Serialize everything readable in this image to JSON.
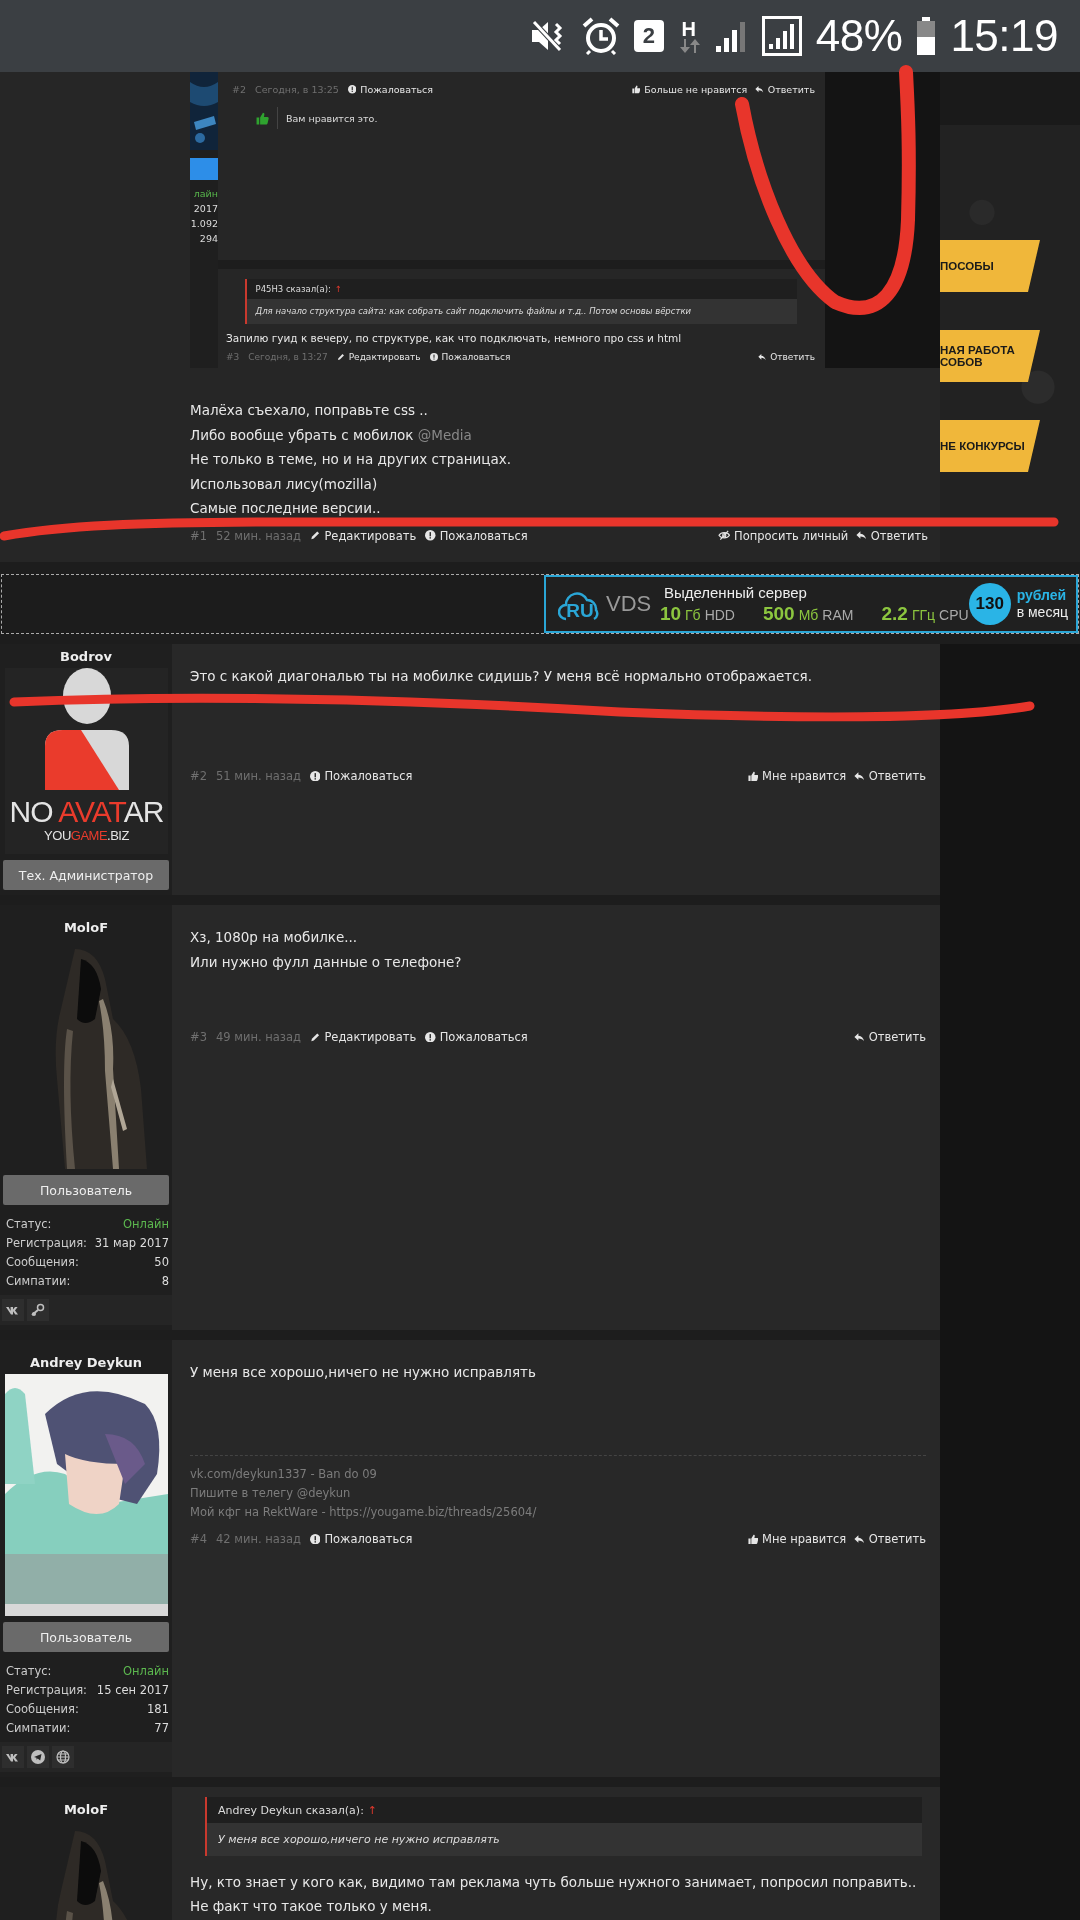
{
  "status_bar": {
    "sim_slot": "2",
    "network": "H",
    "battery": "48%",
    "time": "15:19"
  },
  "first_post": {
    "embedded_screenshot": {
      "user_fragment": {
        "status": "лайн",
        "stats": [
          "2017",
          "1.092",
          "294"
        ]
      },
      "post": {
        "number": "#2",
        "time": "Сегодня, в 13:25",
        "left_actions": [
          {
            "kind": "report",
            "label": "Пожаловаться"
          }
        ],
        "right_actions": [
          {
            "kind": "like",
            "label": "Больше не нравится"
          },
          {
            "kind": "reply",
            "label": "Ответить"
          }
        ],
        "like_note": "Вам нравится это."
      },
      "reply": {
        "quote": {
          "author": "P45H3 сказал(а):",
          "arrow": "↑",
          "text": "Для начало структура сайта: как собрать сайт подключить файлы и т.д.. Потом основы вёрстки"
        },
        "text": "Запилю гуид к вечеру, по структуре, как что подключать, немного про css и html",
        "number": "#3",
        "time": "Сегодня, в 13:27",
        "left_actions": [
          {
            "kind": "edit",
            "label": "Редактировать"
          },
          {
            "kind": "report",
            "label": "Пожаловаться"
          }
        ],
        "right_actions": [
          {
            "kind": "reply",
            "label": "Ответить"
          }
        ]
      }
    },
    "lines": [
      {
        "text": "Малёха съехало, поправьте css .."
      },
      {
        "text": "Либо вообще убрать с мобилок ",
        "mention": "@Media"
      },
      {
        "text": "Не только в теме, но и на других страницах."
      },
      {
        "text": "Использовал лису(mozilla)"
      },
      {
        "text": "Самые последние версии.."
      }
    ],
    "number": "#1",
    "time": "52 мин. назад",
    "left_actions": [
      {
        "kind": "edit",
        "label": "Редактировать"
      },
      {
        "kind": "report",
        "label": "Пожаловаться"
      }
    ],
    "right_actions": [
      {
        "kind": "private",
        "label": "Попросить личный"
      },
      {
        "kind": "reply",
        "label": "Ответить"
      }
    ]
  },
  "side_buttons": [
    {
      "lines": [
        "ПОСОБЫ"
      ]
    },
    {
      "lines": [
        "НАЯ РАБОТА",
        "СОБОВ"
      ]
    },
    {
      "lines": [
        "НЕ КОНКУРСЫ"
      ]
    }
  ],
  "ad": {
    "logo_mark": "RU",
    "logo_name": "VDS",
    "title": "Выделенный сервер",
    "specs": [
      {
        "value": "10",
        "unit": "Гб",
        "label": "HDD"
      },
      {
        "value": "500",
        "unit": "Мб",
        "label": "RAM"
      },
      {
        "value": "2.2",
        "unit": "ГГц",
        "label": "CPU"
      }
    ],
    "price": "130",
    "price_unit": "рублей",
    "price_period": "в месяц"
  },
  "posts": [
    {
      "author": {
        "name": "Bodrov",
        "avatar": {
          "kind": "default",
          "title_parts": [
            {
              "text": "NO ",
              "accent": false
            },
            {
              "text": "AVAT",
              "accent": true
            },
            {
              "text": "AR",
              "accent": false
            }
          ],
          "subtitle_parts": [
            {
              "text": "YOU",
              "accent": false
            },
            {
              "text": "GAME",
              "accent": true
            },
            {
              "text": ".BIZ",
              "accent": false
            }
          ]
        },
        "role": "Тех. Администратор"
      },
      "lines": [
        {
          "text": "Это с какой диагональю ты на мобилке сидишь? У меня всё нормально отображается."
        }
      ],
      "number": "#2",
      "time": "51 мин. назад",
      "left_actions": [
        {
          "kind": "report",
          "label": "Пожаловаться"
        }
      ],
      "right_actions": [
        {
          "kind": "like",
          "label": "Мне нравится"
        },
        {
          "kind": "reply",
          "label": "Ответить"
        }
      ]
    },
    {
      "author": {
        "name": "MoloF",
        "avatar": {
          "kind": "hooded"
        },
        "role": "Пользователь",
        "stats": [
          {
            "label": "Статус:",
            "value": "Онлайн",
            "kind": "online"
          },
          {
            "label": "Регистрация:",
            "value": "31 мар 2017",
            "kind": "plain"
          },
          {
            "label": "Сообщения:",
            "value": "50",
            "kind": "plain"
          },
          {
            "label": "Симпатии:",
            "value": "8",
            "kind": "plain"
          }
        ],
        "social": [
          {
            "kind": "vk"
          },
          {
            "kind": "steam"
          }
        ]
      },
      "lines": [
        {
          "text": "Хз, 1080р на мобилке..."
        },
        {
          "text": "Или нужно фулл данные о телефоне?"
        }
      ],
      "number": "#3",
      "time": "49 мин. назад",
      "left_actions": [
        {
          "kind": "edit",
          "label": "Редактировать"
        },
        {
          "kind": "report",
          "label": "Пожаловаться"
        }
      ],
      "right_actions": [
        {
          "kind": "reply",
          "label": "Ответить"
        }
      ]
    },
    {
      "author": {
        "name": "Andrey Deykun",
        "avatar": {
          "kind": "drawing"
        },
        "role": "Пользователь",
        "stats": [
          {
            "label": "Статус:",
            "value": "Онлайн",
            "kind": "online"
          },
          {
            "label": "Регистрация:",
            "value": "15 сен 2017",
            "kind": "plain"
          },
          {
            "label": "Сообщения:",
            "value": "181",
            "kind": "plain"
          },
          {
            "label": "Симпатии:",
            "value": "77",
            "kind": "plain"
          }
        ],
        "social": [
          {
            "kind": "vk"
          },
          {
            "kind": "telegram"
          },
          {
            "kind": "globe"
          }
        ]
      },
      "lines": [
        {
          "text": "У меня все хорошо,ничего не нужно исправлять"
        }
      ],
      "signature": [
        "vk.com/deykun1337 - Ban do 09",
        "Пишите в телегу @deykun",
        "Мой кфг на RektWare - https://yougame.biz/threads/25604/"
      ],
      "number": "#4",
      "time": "42 мин. назад",
      "left_actions": [
        {
          "kind": "report",
          "label": "Пожаловаться"
        }
      ],
      "right_actions": [
        {
          "kind": "like",
          "label": "Мне нравится"
        },
        {
          "kind": "reply",
          "label": "Ответить"
        }
      ]
    },
    {
      "author": {
        "name": "MoloF",
        "avatar": {
          "kind": "hooded"
        }
      },
      "quote": {
        "author": "Andrey Deykun сказал(а):",
        "arrow": "↑",
        "text": "У меня все хорошо,ничего не нужно исправлять"
      },
      "lines": [
        {
          "text": "Ну, кто знает у кого как, видимо там реклама чуть больше нужного занимает, попросил поправить.."
        },
        {
          "text": "Не факт что такое только у меня."
        }
      ]
    }
  ],
  "scribbles": [
    {
      "kind": "loop"
    },
    {
      "kind": "stroke"
    },
    {
      "kind": "stroke"
    }
  ]
}
